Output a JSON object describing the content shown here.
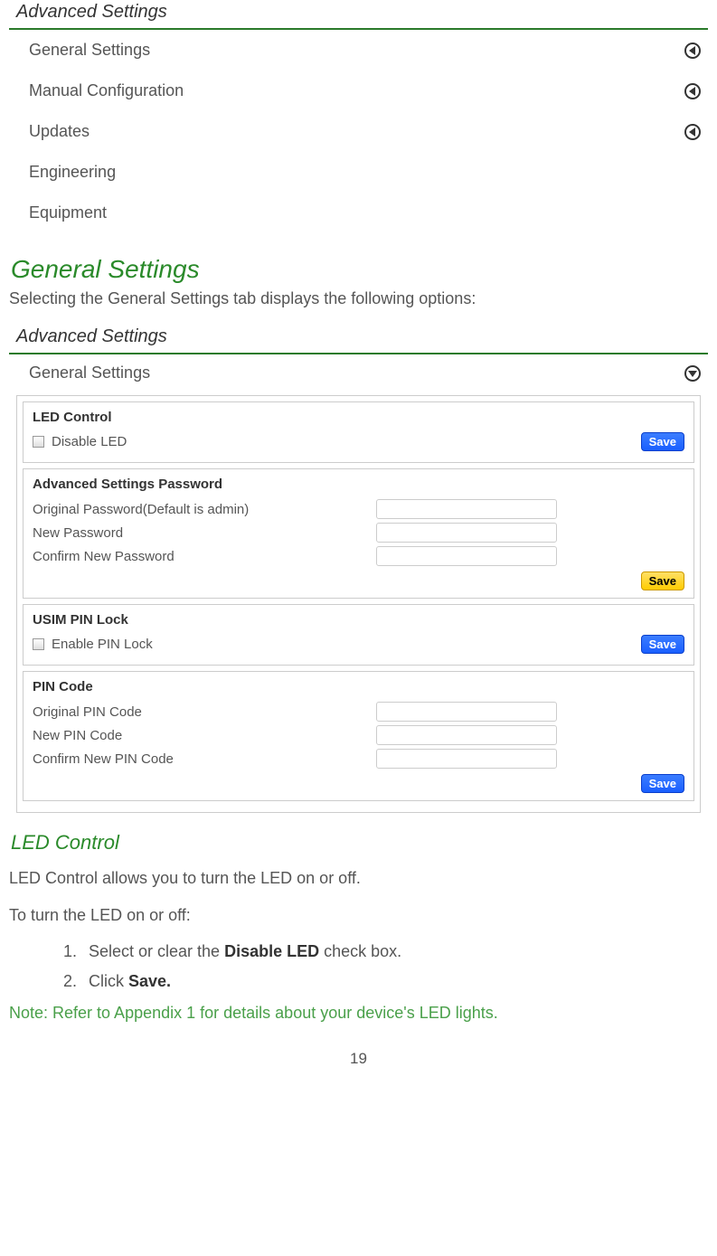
{
  "screenshot1": {
    "title": "Advanced Settings",
    "items": [
      {
        "label": "General Settings",
        "has_arrow": true
      },
      {
        "label": "Manual Configuration",
        "has_arrow": true
      },
      {
        "label": "Updates",
        "has_arrow": true
      },
      {
        "label": "Engineering",
        "has_arrow": false
      },
      {
        "label": "Equipment",
        "has_arrow": false
      }
    ]
  },
  "section": {
    "heading": "General Settings",
    "intro": "Selecting the General Settings tab displays the following options:"
  },
  "screenshot2": {
    "title": "Advanced Settings",
    "sub_title": "General Settings",
    "led_box": {
      "title": "LED Control",
      "checkbox_label": "Disable LED",
      "save": "Save"
    },
    "pw_box": {
      "title": "Advanced Settings Password",
      "field1": "Original Password(Default is admin)",
      "field2": "New Password",
      "field3": "Confirm New Password",
      "save": "Save"
    },
    "pin_lock_box": {
      "title": "USIM PIN Lock",
      "checkbox_label": "Enable PIN Lock",
      "save": "Save"
    },
    "pin_code_box": {
      "title": "PIN Code",
      "field1": "Original PIN Code",
      "field2": "New PIN Code",
      "field3": "Confirm New PIN Code",
      "save": "Save"
    }
  },
  "subsection": {
    "heading": "LED Control",
    "p1": "LED Control allows you to turn the LED on or off.",
    "p2": "To turn the LED on or off:",
    "step1_pre": "Select or clear the ",
    "step1_bold": "Disable LED",
    "step1_post": " check box.",
    "step2_pre": "Click ",
    "step2_bold": "Save.",
    "note": "Note: Refer to Appendix 1 for details about your device's LED lights."
  },
  "page_number": "19"
}
